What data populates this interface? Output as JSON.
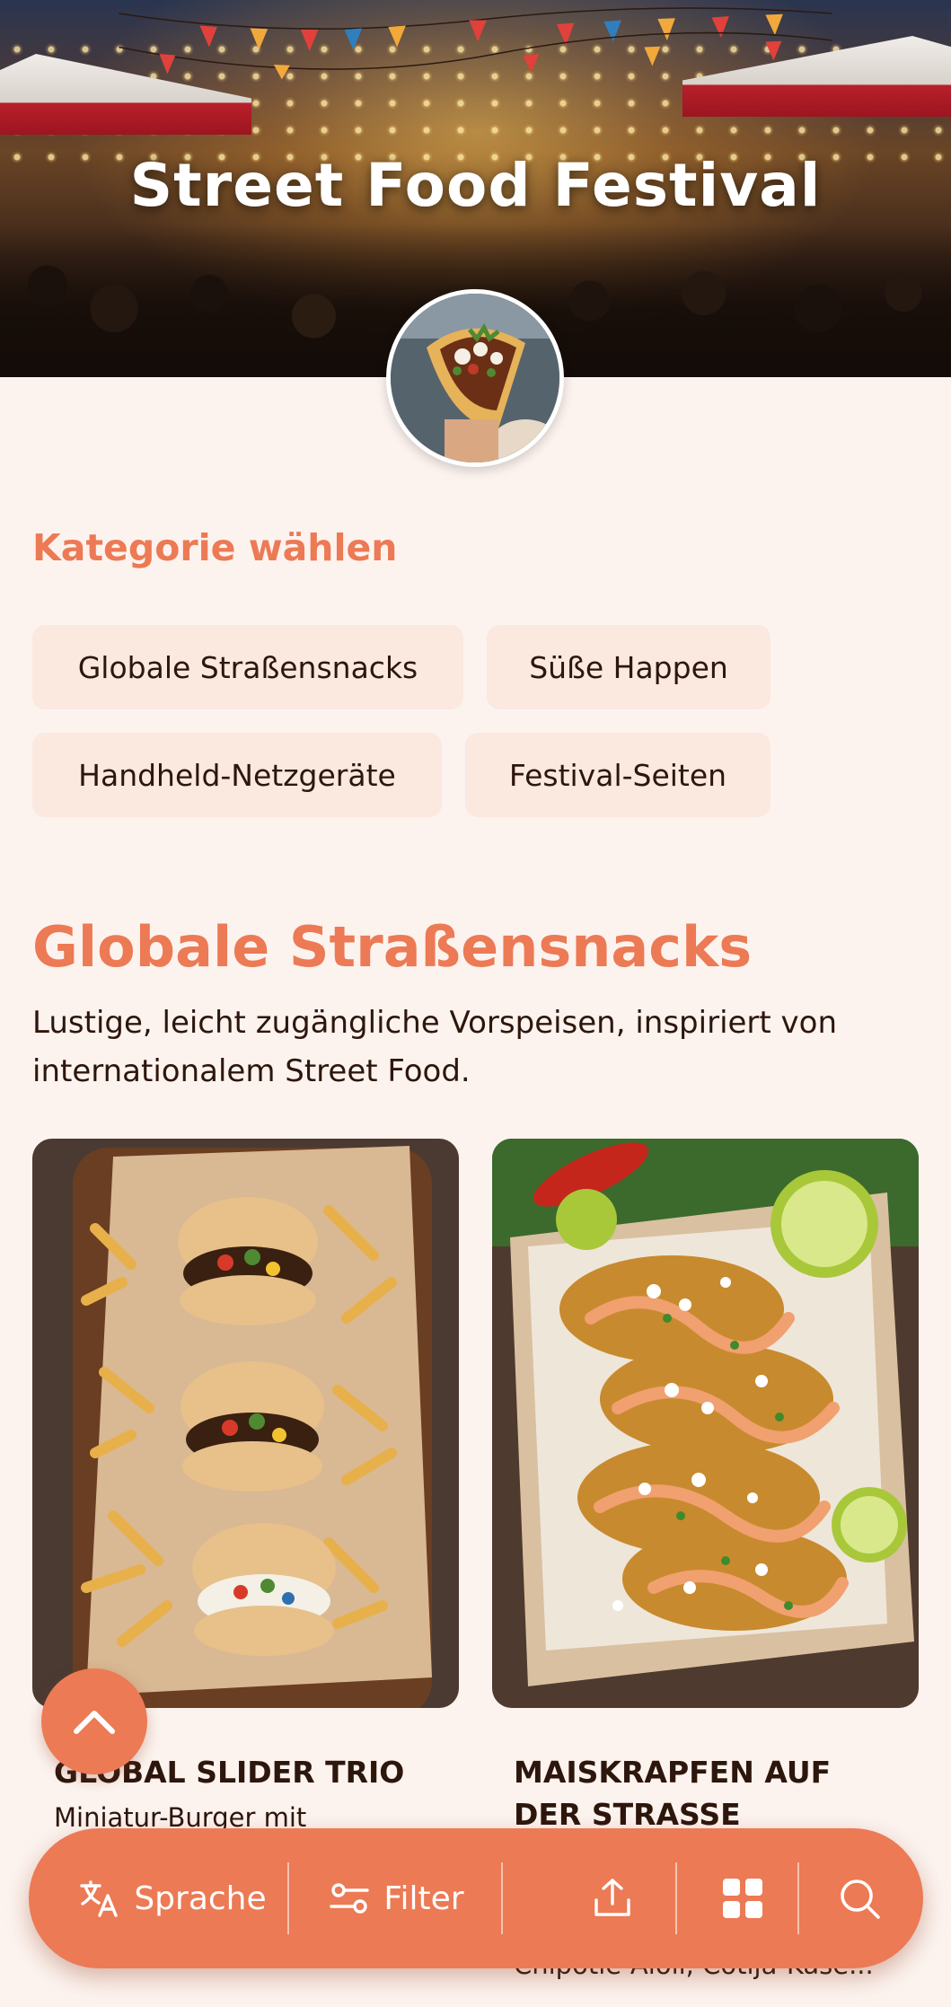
{
  "hero": {
    "title": "Street Food Festival"
  },
  "categories": {
    "heading": "Kategorie wählen",
    "chips": [
      "Globale Straßensnacks",
      "Süße Happen",
      "Handheld-Netzgeräte",
      "Festival-Seiten"
    ]
  },
  "section": {
    "title": "Globale Straßensnacks",
    "description": "Lustige, leicht zugängliche Vorspeisen, inspiriert von internationalem Street Food."
  },
  "cards": [
    {
      "title": "Global Slider Trio",
      "description": "Miniatur-Burger mit"
    },
    {
      "title": "Maiskrapfen auf der Straße",
      "description": "Chipotle-Aioli, Cotija-Käse..."
    }
  ],
  "bottom_bar": {
    "language_label": "Sprache",
    "filter_label": "Filter"
  },
  "icons": {
    "scroll_top": "chevron-up-icon",
    "language": "translate-icon",
    "filter": "sliders-icon",
    "share": "share-icon",
    "grid": "grid-icon",
    "search": "search-icon"
  },
  "colors": {
    "accent": "#ec7a55",
    "background": "#fcf3ef",
    "chip_background": "#fbe8df",
    "text": "#2d160c"
  }
}
